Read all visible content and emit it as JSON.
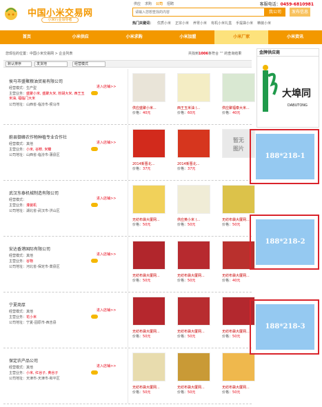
{
  "header": {
    "brand": "中国小米交易网",
    "slogan": "小米行业领导者",
    "topnav": [
      "供应",
      "求购",
      "公司",
      "招聘"
    ],
    "topnav_active": 2,
    "hotline_label": "客服电话：",
    "hotline": "0459-6810981",
    "search_placeholder": "请输入您想查找的内容",
    "search_button": "我公司",
    "publish_button": "发布信息",
    "hotsearch_label": "热门关键词：",
    "hotsearch": [
      "优质小米",
      "正宗小米",
      "养胃小米",
      "有机小米礼盒",
      "手提袋小米",
      "精装小米"
    ]
  },
  "mainnav": [
    "首页",
    "小米供应",
    "小米求购",
    "小米加盟",
    "小米厂家",
    "小米资讯"
  ],
  "mainnav_active": 4,
  "breadcrumb": "您现在的位置：中国小米交易网 > 企业列表",
  "found": {
    "prefix": "共找到",
    "count": "1006",
    "suffix": "条符合 ",
    "mid": "“” 的查询结果"
  },
  "filter": {
    "sort": "默认排序",
    "region": "发货地",
    "mode": "经营模式"
  },
  "labels": {
    "mode": "经营模式：",
    "main": "主营业务：",
    "addr": "公司地址：",
    "enter": "进入店铺>>",
    "price": "价格："
  },
  "companies": [
    {
      "name": "侯马市盛聚粮油贸易有限公司",
      "mode": "生产型",
      "main": "盛聚小米, 盛聚大米, 粉胡大米, 西王玉米油, 福临门大米",
      "addr": "山西省-临汾市-侯马市",
      "products": [
        {
          "name": "供应盛聚小米...",
          "price": "40元",
          "color": "#e9e4d8"
        },
        {
          "name": "西王玉米油 (...",
          "price": "60元",
          "color": "#f4edc4"
        },
        {
          "name": "供应聚福泰大米...",
          "price": "40元",
          "color": "#d9e8d2"
        }
      ]
    },
    {
      "name": "蔚县御峰农作物种植专业合作社",
      "mode": "其他",
      "main": "小米, 谷糁, 米糠",
      "addr": "山西省-临汾市-蒲县区",
      "products": [
        {
          "name": "2014新晋北...",
          "price": "37元",
          "color": "#d22a1c"
        },
        {
          "name": "2014新晋北...",
          "price": "37元",
          "color": "#d6361e"
        },
        {
          "name": "",
          "price": "",
          "color": "#e9e9e9",
          "noimg": "暂无\n图片"
        }
      ]
    },
    {
      "name": "武汉东泰机械制造有限公司",
      "mode": "",
      "main": "灌装机",
      "addr": "湖北省-武汉市-洪山区",
      "products": [
        {
          "name": "无纺布袋大厦网...",
          "price": "50元",
          "color": "#f1d15a"
        },
        {
          "name": "供应黄小米 (...",
          "price": "50元",
          "color": "#f0ecd6"
        },
        {
          "name": "无纺布袋大厦网...",
          "price": "50元",
          "color": "#dcc24a"
        }
      ]
    },
    {
      "name": "安达香港国际有限公司",
      "mode": "其他",
      "main": "谷物",
      "addr": "河北省-保定市-蒿县区",
      "products": [
        {
          "name": "无纺布袋大厦网...",
          "price": "50元",
          "color": "#b1262c"
        },
        {
          "name": "无纺布袋大厦网...",
          "price": "50元",
          "color": "#b72a2f"
        },
        {
          "name": "无纺布袋大厦网...",
          "price": "40元",
          "color": "#b9302d"
        }
      ]
    },
    {
      "name": "宁夏商厚",
      "mode": "其他",
      "main": "花小米",
      "addr": "宁夏-固原市-西吉县",
      "products": [
        {
          "name": "无纺布袋大厦网...",
          "price": "50元",
          "color": "#b5272d"
        },
        {
          "name": "无纺布袋大厦网...",
          "price": "50元",
          "color": "#b82d30"
        },
        {
          "name": "无纺布袋大厦网...",
          "price": "50元",
          "color": "#b3282e"
        }
      ]
    },
    {
      "name": "保定农产品公司",
      "mode": "其他",
      "main": "小米, 红谷子, 黄谷子",
      "addr": "天津市-天津市-和平区",
      "products": [
        {
          "name": "无纺布袋大厦网...",
          "price": "50元",
          "color": "#e8dcae"
        },
        {
          "name": "无纺布袋大厦网...",
          "price": "50元",
          "color": "#c99a36"
        },
        {
          "name": "无纺布袋大厦网...",
          "price": "50元",
          "color": "#efb84d"
        }
      ]
    }
  ],
  "supplier": {
    "heading": "金牌供应商",
    "logo_text": "大埠同",
    "logo_sub": "DABUTONG"
  },
  "ads": [
    "188*218-1",
    "188*218-2",
    "188*218-3"
  ]
}
